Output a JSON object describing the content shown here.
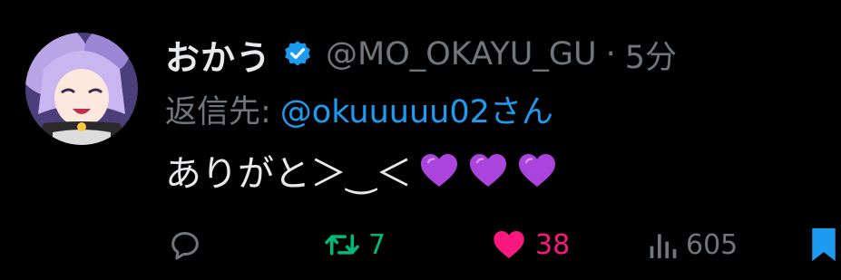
{
  "author": {
    "display_name": "おかう",
    "handle": "@MO_OKAYU_GU",
    "separator": "·",
    "time_ago": "5分",
    "verified": true
  },
  "reply": {
    "prefix": "返信先:",
    "target": "@okuuuuu02さん"
  },
  "tweet": {
    "text": "ありがと＞‿＜",
    "emoji": [
      "purple-heart",
      "purple-heart",
      "purple-heart"
    ]
  },
  "actions": {
    "reply_count": "",
    "retweet_count": "7",
    "like_count": "38",
    "view_count": "605"
  },
  "colors": {
    "background": "#000000",
    "text": "#e7e9ea",
    "muted": "#71767b",
    "link": "#1d9bf0",
    "retweet_active": "#00ba7c",
    "like_active": "#f91880",
    "bookmark_active": "#1d9bf0",
    "emoji_heart": "#aa44dd"
  }
}
